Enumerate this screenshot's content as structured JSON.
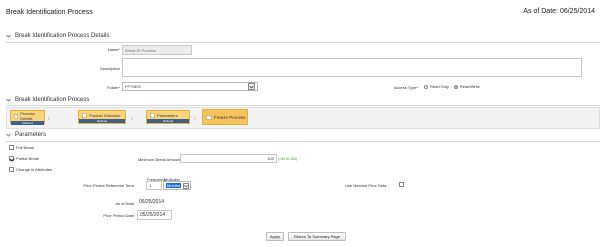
{
  "page": {
    "title": "Break Identification Process",
    "as_of_label": "As of Date:",
    "as_of_value": "06/25/2014"
  },
  "details_section": {
    "header": "Break Identification Process Details",
    "name_label": "Name",
    "name_value": "Break ID Process",
    "description_label": "Description",
    "description_value": "",
    "folder_label": "Folder",
    "folder_value": "FFTSEG",
    "access_label": "Access Type",
    "access_options": [
      "Read Only",
      "Read/Write"
    ],
    "access_selected": "Read/Write"
  },
  "process_section": {
    "header": "Break Identification Process",
    "steps": [
      {
        "label": "Process Details",
        "status": "Defined"
      },
      {
        "label": "Product Selection",
        "status": "Defined"
      },
      {
        "label": "Parameters",
        "status": "Defined"
      },
      {
        "label": "Freeze Process",
        "status": ""
      }
    ]
  },
  "parameters_section": {
    "header": "Parameters",
    "full_break_label": "Full Break",
    "full_break_checked": false,
    "partial_break_label": "Partial Break",
    "partial_break_checked": true,
    "change_attributes_label": "Change in Attributes",
    "change_attributes_checked": false,
    "min_break_label": "Minimum Break Amount",
    "min_break_value": "100",
    "min_break_hint": "(>50 to 100)",
    "prior_period_ref_label": "Prior Period Reference Term",
    "frequency_header": "Frequency",
    "multiplier_header": "Multiplier",
    "frequency_value": "1",
    "multiplier_value": "Months",
    "use_nearest_label": "Use Nearest Prior Data",
    "use_nearest_checked": false,
    "as_of_date_label": "As of Date",
    "as_of_date_value": "06/25/2014",
    "prior_period_date_label": "Prior Period Date",
    "prior_period_date_value": "05/25/2014"
  },
  "actions": {
    "apply_label": "Apply",
    "return_label": "Return To Summary Page"
  },
  "colors": {
    "step_fill": "#fbd57b",
    "step_status_bar": "#3f5f8f",
    "hint_green": "#2c9a2c",
    "select_highlight": "#1e6fd9"
  }
}
